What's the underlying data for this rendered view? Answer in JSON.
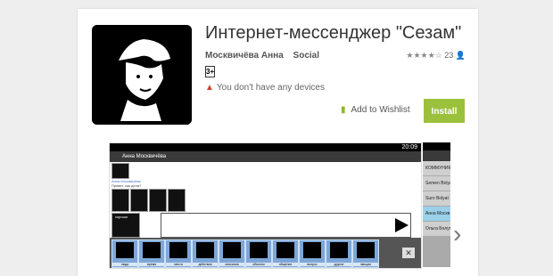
{
  "app": {
    "title": "Интернет-мессенджер \"Сезам\"",
    "author": "Москвичёва Анна",
    "category": "Social",
    "rating_count": "23",
    "content_rating": "3+",
    "warning": "You don't have any devices",
    "wishlist_label": "Add to Wishlist",
    "install_label": "Install"
  },
  "rating": {
    "stars_filled": 4,
    "stars_total": 5
  },
  "screenshot1": {
    "status_time": "20:09",
    "header_name": "Анна Москвичёва",
    "sender_name": "Анна Москвичёва",
    "message_text": "Привет, как дела?",
    "big_icon_label": "хорошо",
    "tiles": [
      {
        "label": "люди"
      },
      {
        "label": "время"
      },
      {
        "label": "места"
      },
      {
        "label": "действия"
      },
      {
        "label": "описания"
      },
      {
        "label": "объекты"
      },
      {
        "label": "общение"
      },
      {
        "label": "вопрос"
      },
      {
        "label": "другие"
      },
      {
        "label": "эмоции"
      }
    ]
  },
  "screenshot2": {
    "items": [
      {
        "label": "КОММУНИКАЦИЯ"
      },
      {
        "label": "Semen Bolyat"
      },
      {
        "label": "Suro Bolyat"
      },
      {
        "label": "Анна Москв"
      },
      {
        "label": "Ольга Болуг"
      }
    ]
  },
  "colors": {
    "install": "#9bc13c",
    "tile": "#7ea7d8"
  }
}
